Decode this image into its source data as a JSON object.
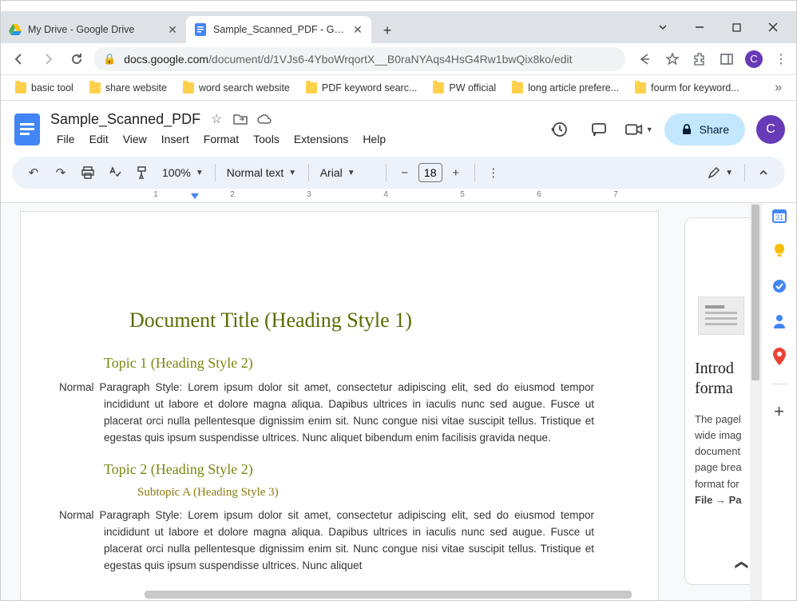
{
  "window": {
    "tabs": [
      {
        "title": "My Drive - Google Drive",
        "active": false
      },
      {
        "title": "Sample_Scanned_PDF - Google D",
        "active": true
      }
    ]
  },
  "addressbar": {
    "domain": "docs.google.com",
    "path": "/document/d/1VJs6-4YboWrqortX__B0raNYAqs4HsG4Rw1bwQix8ko/edit"
  },
  "bookmarks": [
    "basic tool",
    "share website",
    "word search website",
    "PDF keyword searc...",
    "PW official",
    "long article prefere...",
    "fourm for keyword..."
  ],
  "doc": {
    "title": "Sample_Scanned_PDF",
    "menus": [
      "File",
      "Edit",
      "View",
      "Insert",
      "Format",
      "Tools",
      "Extensions",
      "Help"
    ],
    "share_label": "Share",
    "avatar": "C"
  },
  "toolbar": {
    "zoom": "100%",
    "style": "Normal text",
    "font": "Arial",
    "fontsize": "18"
  },
  "ruler_numbers": [
    "1",
    "2",
    "3",
    "4",
    "5",
    "6",
    "7"
  ],
  "content": {
    "h1": "Document Title (Heading Style 1)",
    "topic1": "Topic 1 (Heading Style 2)",
    "p1a": "Normal Paragraph Style: Lorem ipsum dolor sit amet, consectetur adipiscing elit, sed do eiusmod tempor",
    "p1b": "incididunt ut labore et dolore magna aliqua. Dapibus ultrices in iaculis nunc sed augue. Fusce ut placerat orci nulla pellentesque dignissim enim sit. Nunc congue nisi vitae suscipit tellus. Tristique et egestas quis ipsum suspendisse ultrices. Nunc aliquet bibendum enim facilisis gravida neque.",
    "topic2": "Topic 2 (Heading Style 2)",
    "subtopicA": "Subtopic A (Heading Style 3)",
    "p2a": "Normal Paragraph Style: Lorem ipsum dolor sit amet, consectetur adipiscing elit, sed do eiusmod tempor",
    "p2b": "incididunt ut labore et dolore magna aliqua. Dapibus ultrices in iaculis nunc sed augue. Fusce ut placerat orci nulla pellentesque dignissim enim sit. Nunc congue nisi vitae suscipit tellus. Tristique et egestas quis ipsum suspendisse ultrices. Nunc aliquet"
  },
  "outline": {
    "title": "Introd forma",
    "body": "The pagel wide imag document page brea format for",
    "bold": "File → Pa"
  }
}
